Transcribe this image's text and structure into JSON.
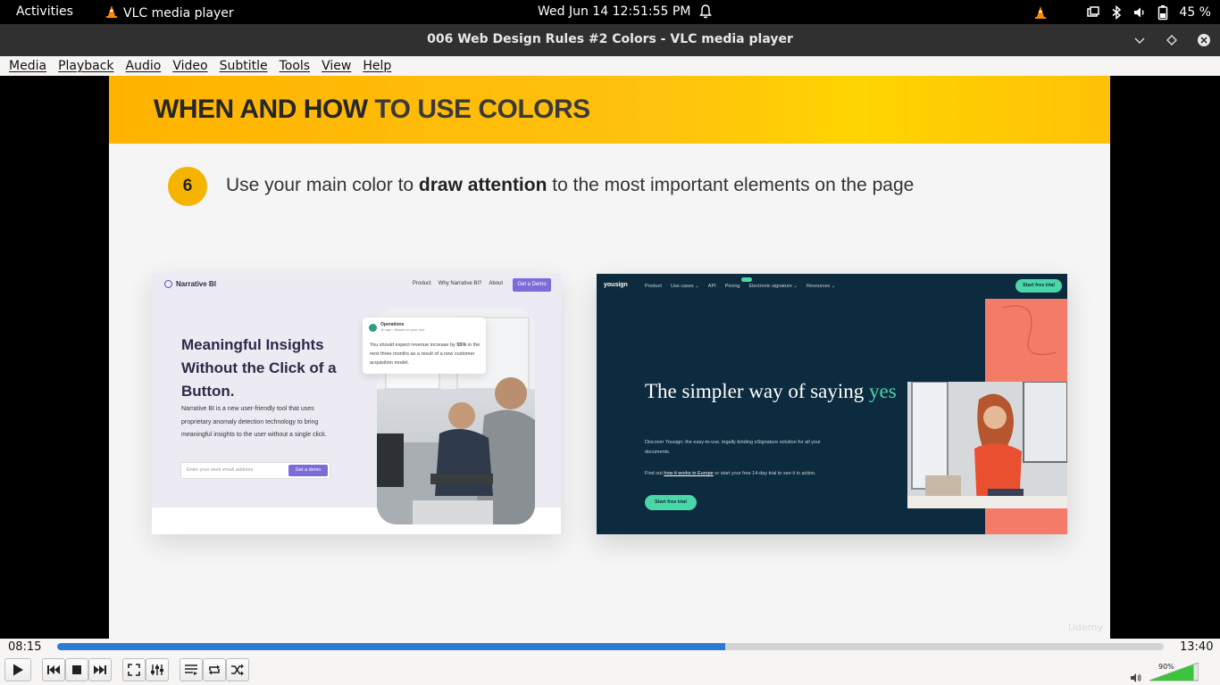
{
  "topbar": {
    "activities": "Activities",
    "app_name": "VLC media player",
    "clock": "Wed Jun 14  12:51:55 PM",
    "battery": "45 %"
  },
  "window": {
    "title": "006 Web Design Rules #2 Colors - VLC media player"
  },
  "menu": {
    "items": [
      "Media",
      "Playback",
      "Audio",
      "Video",
      "Subtitle",
      "Tools",
      "View",
      "Help"
    ]
  },
  "slide": {
    "heading_bold": "WHEN AND HOW",
    "heading_rest": " TO USE COLORS",
    "rule_number": "6",
    "rule_pre": "Use your main color to ",
    "rule_bold": "draw attention",
    "rule_post": " to the most important elements on the page",
    "watermark": "Udemy",
    "narrative": {
      "logo": "Narrative BI",
      "nav": [
        "Product",
        "Why Narrative BI?",
        "About"
      ],
      "demo_button": "Get a Demo",
      "hero": "Meaningful Insights Without the Click of a Button.",
      "description": "Narrative BI is a new user-friendly tool that uses proprietary anomaly detection technology to bring meaningful insights to the user without a single click.",
      "email_placeholder": "Enter your work email address",
      "email_button": "Get a demo",
      "notif_title": "Operations",
      "notif_sub": "1h ago • Based on your rule",
      "notif_pre": "You should expect revenue increase by ",
      "notif_bold": "55%",
      "notif_post": " in the next three months as a result of a new customer acquisition model."
    },
    "yousign": {
      "logo": "yousign",
      "nav": [
        "Product",
        "Use cases ⌄",
        "API",
        "Pricing",
        "Electronic signature ⌄",
        "Resources ⌄"
      ],
      "top_button": "Start free trial",
      "headline_pre": "The simpler way of saying ",
      "headline_accent": "yes",
      "sub1": "Discover Yousign: the easy-to-use, legally binding eSignature solution for all your documents.",
      "sub2_pre": "Find out ",
      "sub2_link": "how it works in Europe",
      "sub2_post": " or start your free 14-day trial to see it in action.",
      "main_button": "Start free trial"
    }
  },
  "player": {
    "elapsed": "08:15",
    "total": "13:40",
    "progress_fraction": 0.604,
    "volume_label": "90%",
    "volume_fraction": 0.9
  },
  "colors": {
    "progress": "#2a7bd1",
    "volume": "#3cc43c",
    "banner": "#ffc20e",
    "yousign_bg": "#0d2b3e",
    "yousign_accent": "#4ad6a8",
    "coral": "#f47b67",
    "narrative_purple": "#7b6cd9"
  },
  "icons": {
    "app": "vlc-cone-icon",
    "bell": "bell-icon",
    "tray": [
      "vlc-cone-icon",
      "screen-icon",
      "bluetooth-icon",
      "speaker-icon",
      "battery-icon"
    ],
    "window": [
      "minimize-icon",
      "maximize-icon",
      "close-icon"
    ],
    "controls": [
      "play-icon",
      "previous-icon",
      "stop-icon",
      "next-icon",
      "fullscreen-icon",
      "extended-settings-icon",
      "playlist-icon",
      "loop-icon",
      "shuffle-icon",
      "volume-icon"
    ]
  }
}
